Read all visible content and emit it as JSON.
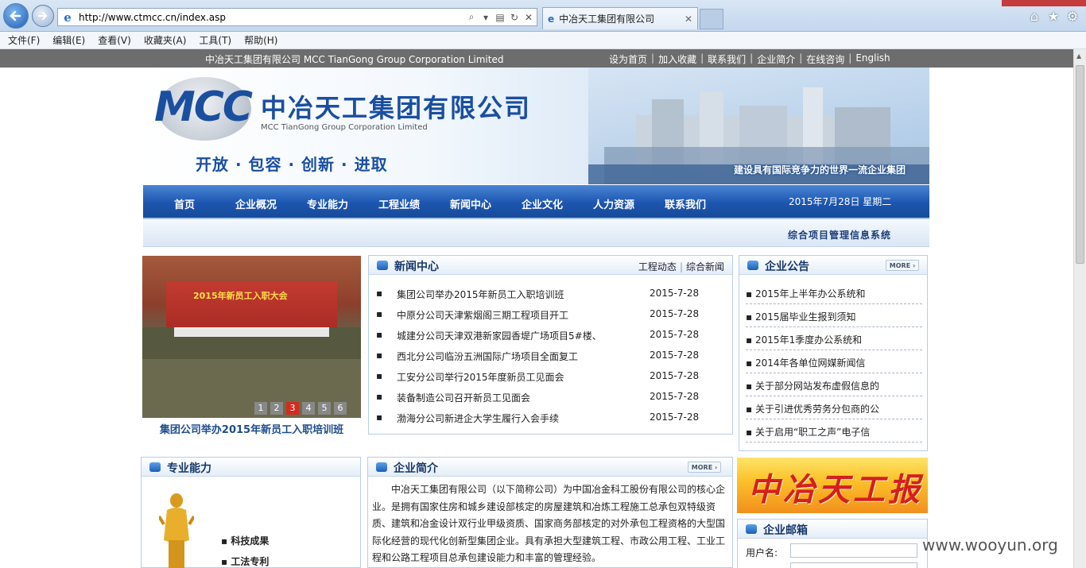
{
  "browser": {
    "url": "http://www.ctmcc.cn/index.asp",
    "tab_title": "中冶天工集团有限公司",
    "tab_close": "✕",
    "menu": [
      "文件(F)",
      "编辑(E)",
      "查看(V)",
      "收藏夹(A)",
      "工具(T)",
      "帮助(H)"
    ]
  },
  "topbar": {
    "company": "中冶天工集团有限公司  MCC TianGong Group Corporation Limited",
    "links": [
      "设为首页",
      "加入收藏",
      "联系我们",
      "企业简介",
      "在线咨询",
      "English"
    ]
  },
  "banner": {
    "logo_mcc": "MCC",
    "logo_cn": "中冶天工集团有限公司",
    "logo_en": "MCC TianGong Group Corporation Limited",
    "slogan": "开放 · 包容 · 创新 · 进取",
    "caption": "建设具有国际竞争力的世界一流企业集团"
  },
  "nav": {
    "items": [
      "首页",
      "企业概况",
      "专业能力",
      "工程业绩",
      "新闻中心",
      "企业文化",
      "人力资源",
      "联系我们"
    ],
    "date": "2015年7月28日  星期二"
  },
  "subnav": {
    "link": "综合项目管理信息系统"
  },
  "slideshow": {
    "stage_text": "2015年新员工入职大会",
    "dots": [
      "1",
      "2",
      "3",
      "4",
      "5",
      "6"
    ],
    "active_dot": 3,
    "caption": "集团公司举办2015年新员工入职培训班"
  },
  "news": {
    "title": "新闻中心",
    "tab1": "工程动态",
    "tab2": "综合新闻",
    "items": [
      {
        "title": "集团公司举办2015年新员工入职培训班",
        "date": "2015-7-28"
      },
      {
        "title": "中原分公司天津紫烟阁三期工程项目开工",
        "date": "2015-7-28"
      },
      {
        "title": "城建分公司天津双港新家园香堤广场项目5#楼、",
        "date": "2015-7-28"
      },
      {
        "title": "西北分公司临汾五洲国际广场项目全面复工",
        "date": "2015-7-28"
      },
      {
        "title": "工安分公司举行2015年度新员工见面会",
        "date": "2015-7-28"
      },
      {
        "title": "装备制造公司召开新员工见面会",
        "date": "2015-7-28"
      },
      {
        "title": "渤海分公司新进企大学生履行入会手续",
        "date": "2015-7-28"
      }
    ]
  },
  "notice": {
    "title": "企业公告",
    "more": "MORE ›",
    "items": [
      "2015年上半年办公系统和",
      "2015届毕业生报到须知",
      "2015年1季度办公系统和",
      "2014年各单位网媒新闻信",
      "关于部分网站发布虚假信息的",
      "关于引进优秀劳务分包商的公",
      "关于启用“职工之声”电子信"
    ]
  },
  "ability": {
    "title": "专业能力",
    "items": [
      "科技成果",
      "工法专利"
    ]
  },
  "intro": {
    "title": "企业简介",
    "more": "MORE ›",
    "text": "中冶天工集团有限公司（以下简称公司）为中国冶金科工股份有限公司的核心企业。是拥有国家住房和城乡建设部核定的房屋建筑和冶炼工程施工总承包双特级资质、建筑和冶金设计双行业甲级资质、国家商务部核定的对外承包工程资格的大型国际化经营的现代化创新型集团企业。具有承担大型建筑工程、市政公用工程、工业工程和公路工程项目总承包建设能力和丰富的管理经验。"
  },
  "newspaper": {
    "text": "中冶天工报"
  },
  "mail": {
    "title": "企业邮箱",
    "user_label": "用户名:"
  },
  "watermark": "www.wooyun.org"
}
